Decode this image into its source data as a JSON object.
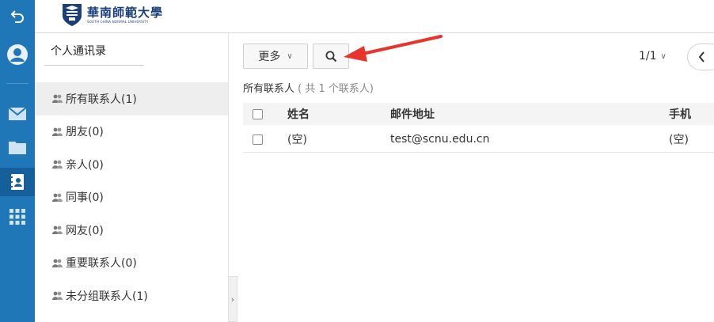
{
  "header": {
    "logo": {
      "name_cn": "華南師範大學",
      "name_en": "SOUTH CHINA NORMAL UNIVERSITY"
    }
  },
  "rail": {
    "icons": [
      "back-icon",
      "user-avatar-icon",
      "mail-icon",
      "folder-icon",
      "contacts-icon",
      "apps-grid-icon"
    ],
    "active": "contacts-icon",
    "accent": "#1f77b8"
  },
  "sidebar": {
    "title": "个人通讯录",
    "groups": [
      {
        "label": "所有联系人(1)",
        "active": true
      },
      {
        "label": "朋友(0)"
      },
      {
        "label": "亲人(0)"
      },
      {
        "label": "同事(0)"
      },
      {
        "label": "网友(0)"
      },
      {
        "label": "重要联系人(0)"
      },
      {
        "label": "未分组联系人(1)"
      }
    ],
    "collapse_glyph": "›"
  },
  "toolbar": {
    "more_label": "更多",
    "more_chevron": "∨",
    "search_icon": "search-icon",
    "pager_text": "1/1",
    "pager_chevron": "∨",
    "prev_icon": "chevron-left-icon"
  },
  "list": {
    "group_name": "所有联系人",
    "group_count": "( 共 1 个联系人)",
    "columns": {
      "name": "姓名",
      "email": "邮件地址",
      "phone": "手机"
    },
    "rows": [
      {
        "name": "(空)",
        "email": "test@scnu.edu.cn",
        "phone": "(空)"
      }
    ]
  },
  "annotation": {
    "arrow_color": "#e8342a"
  }
}
